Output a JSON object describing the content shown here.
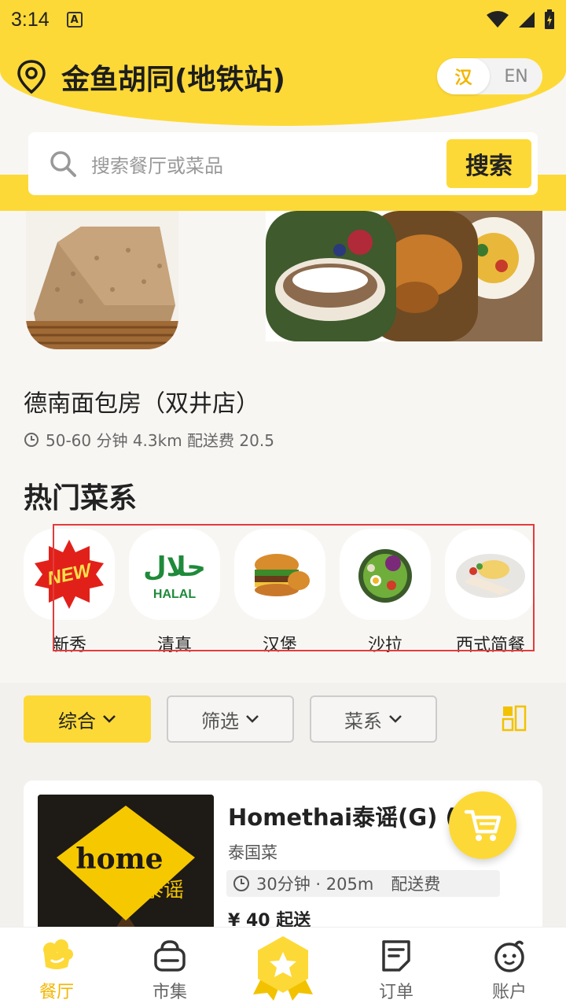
{
  "status": {
    "time": "3:14",
    "a_icon": "A"
  },
  "header": {
    "location": "金鱼胡同(地铁站)",
    "lang_cn": "汉",
    "lang_en": "EN"
  },
  "search": {
    "placeholder": "搜索餐厅或菜品",
    "button": "搜索"
  },
  "featured": {
    "name": "德南面包房（双井店）",
    "meta": "50-60 分钟 4.3km 配送费 20.5"
  },
  "hot": {
    "title": "热门菜系"
  },
  "categories": [
    {
      "label": "新秀",
      "badge": "NEW"
    },
    {
      "label": "清真",
      "badge_ar": "حلال",
      "badge_en": "HALAL"
    },
    {
      "label": "汉堡"
    },
    {
      "label": "沙拉"
    },
    {
      "label": "西式简餐"
    }
  ],
  "filters": {
    "sort": "综合",
    "filter": "筛选",
    "cuisine": "菜系"
  },
  "card": {
    "name": "Homethai泰谣(G) (三",
    "cuisine": "泰国菜",
    "meta": "30分钟 · 205m",
    "fee": "配送费",
    "min": "¥ 40 起送",
    "logo_text": "home",
    "logo_cn": "泰谣"
  },
  "nav": {
    "restaurant": "餐厅",
    "market": "市集",
    "orders": "订单",
    "account": "账户"
  },
  "colors": {
    "accent": "#fdd937",
    "accent_text": "#f2b600",
    "highlight": "#e23c3c"
  }
}
